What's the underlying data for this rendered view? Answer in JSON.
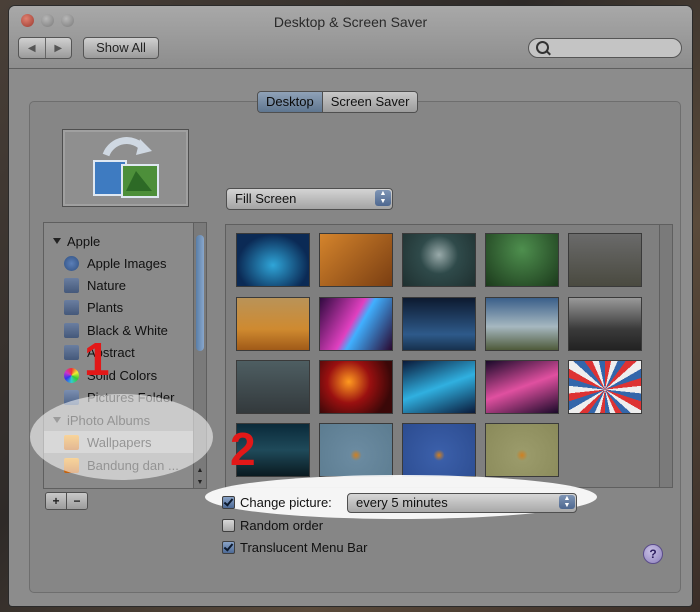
{
  "window": {
    "title": "Desktop & Screen Saver"
  },
  "toolbar": {
    "back_icon": "◀",
    "forward_icon": "▶",
    "show_all_label": "Show All"
  },
  "tabs": [
    {
      "label": "Desktop",
      "selected": true
    },
    {
      "label": "Screen Saver",
      "selected": false
    }
  ],
  "fill_mode": {
    "value": "Fill Screen"
  },
  "sources": {
    "apple_header": "Apple",
    "apple_items": [
      "Apple Images",
      "Nature",
      "Plants",
      "Black & White",
      "Abstract",
      "Solid Colors",
      "Pictures Folder"
    ],
    "iphoto_header": "iPhoto Albums",
    "iphoto_items": [
      "Wallpapers",
      "Bandung dan ..."
    ]
  },
  "list_buttons": {
    "add": "+",
    "remove": "−"
  },
  "options": {
    "change_picture": {
      "label": "Change picture:",
      "checked": true
    },
    "interval": {
      "value": "every 5 minutes"
    },
    "random_order": {
      "label": "Random order",
      "checked": false
    },
    "translucent": {
      "label": "Translucent Menu Bar",
      "checked": true
    }
  },
  "help": "?",
  "annotations": {
    "one": "1",
    "two": "2"
  },
  "colors": {
    "annotation": "#e21818",
    "accent": "#4e6890"
  }
}
